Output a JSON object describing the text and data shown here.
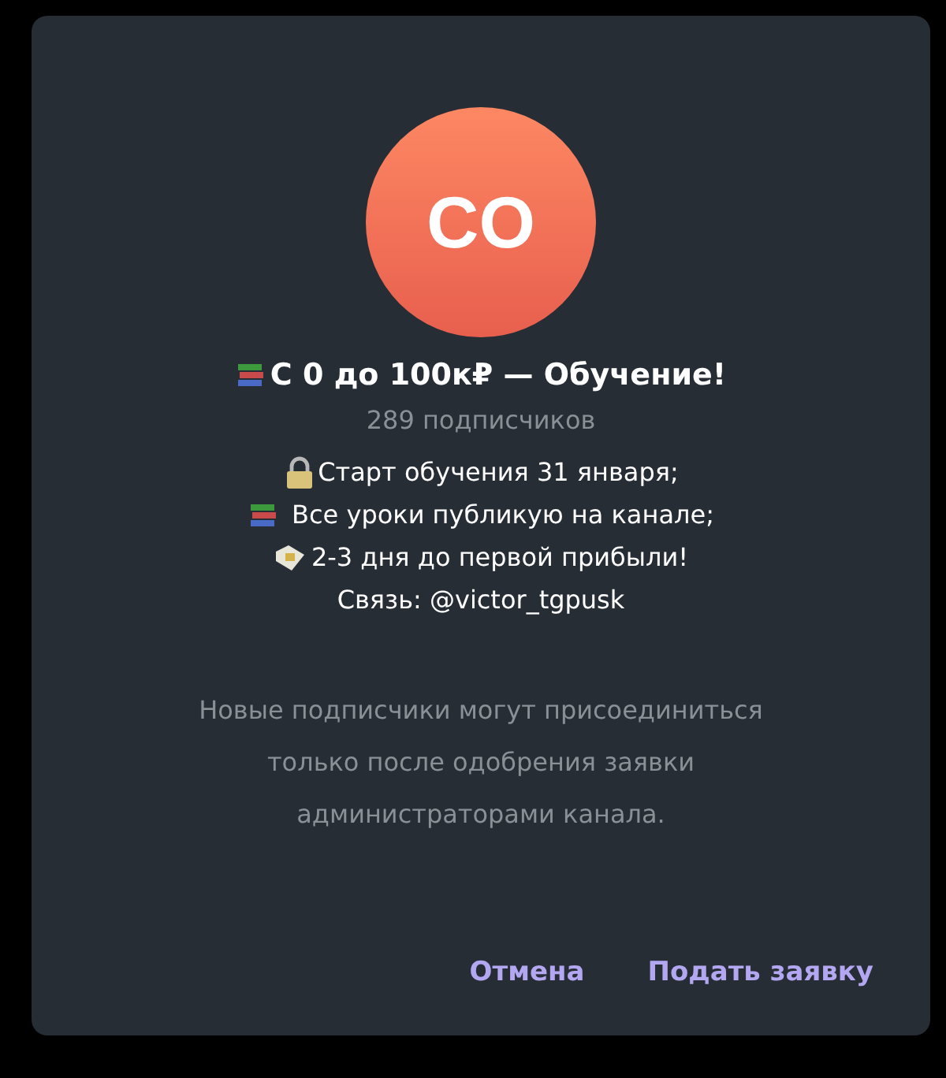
{
  "avatar": {
    "initials": "CO"
  },
  "title": "С 0 до 100к₽ — Обучение!",
  "subscribers": "289 подписчиков",
  "description": [
    "Старт обучения 31 января;",
    "Все уроки публикую на канале;",
    "2-3 дня до первой прибыли!",
    "Связь: @victor_tgpusk"
  ],
  "notice": "Новые подписчики могут присоединиться только после одобрения заявки администраторами канала.",
  "buttons": [
    "Отмена",
    "Подать заявку"
  ]
}
